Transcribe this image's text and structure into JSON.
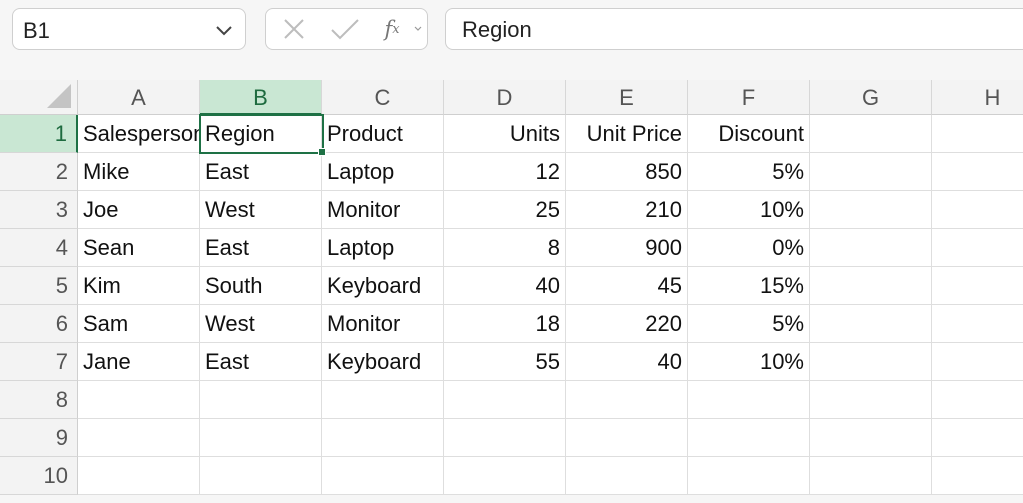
{
  "formula_bar": {
    "name_box": "B1",
    "formula_value": "Region",
    "cancel_icon": "close-icon",
    "confirm_icon": "check-icon",
    "fx_label": "f",
    "fx_sub": "x"
  },
  "columns": [
    "A",
    "B",
    "C",
    "D",
    "E",
    "F",
    "G",
    "H"
  ],
  "selected_column": "B",
  "selected_row": "1",
  "rows": [
    {
      "num": "1",
      "cells": [
        "Salesperson",
        "Region",
        "Product",
        "Units",
        "Unit Price",
        "Discount",
        "",
        ""
      ]
    },
    {
      "num": "2",
      "cells": [
        "Mike",
        "East",
        "Laptop",
        "12",
        "850",
        "5%",
        "",
        ""
      ]
    },
    {
      "num": "3",
      "cells": [
        "Joe",
        "West",
        "Monitor",
        "25",
        "210",
        "10%",
        "",
        ""
      ]
    },
    {
      "num": "4",
      "cells": [
        "Sean",
        "East",
        "Laptop",
        "8",
        "900",
        "0%",
        "",
        ""
      ]
    },
    {
      "num": "5",
      "cells": [
        "Kim",
        "South",
        "Keyboard",
        "40",
        "45",
        "15%",
        "",
        ""
      ]
    },
    {
      "num": "6",
      "cells": [
        "Sam",
        "West",
        "Monitor",
        "18",
        "220",
        "5%",
        "",
        ""
      ]
    },
    {
      "num": "7",
      "cells": [
        "Jane",
        "East",
        "Keyboard",
        "55",
        "40",
        "10%",
        "",
        ""
      ]
    },
    {
      "num": "8",
      "cells": [
        "",
        "",
        "",
        "",
        "",
        "",
        "",
        ""
      ]
    },
    {
      "num": "9",
      "cells": [
        "",
        "",
        "",
        "",
        "",
        "",
        "",
        ""
      ]
    },
    {
      "num": "10",
      "cells": [
        "",
        "",
        "",
        "",
        "",
        "",
        "",
        ""
      ]
    }
  ],
  "colors": {
    "selection": "#1e7145",
    "header_highlight": "#c9e7d3"
  }
}
